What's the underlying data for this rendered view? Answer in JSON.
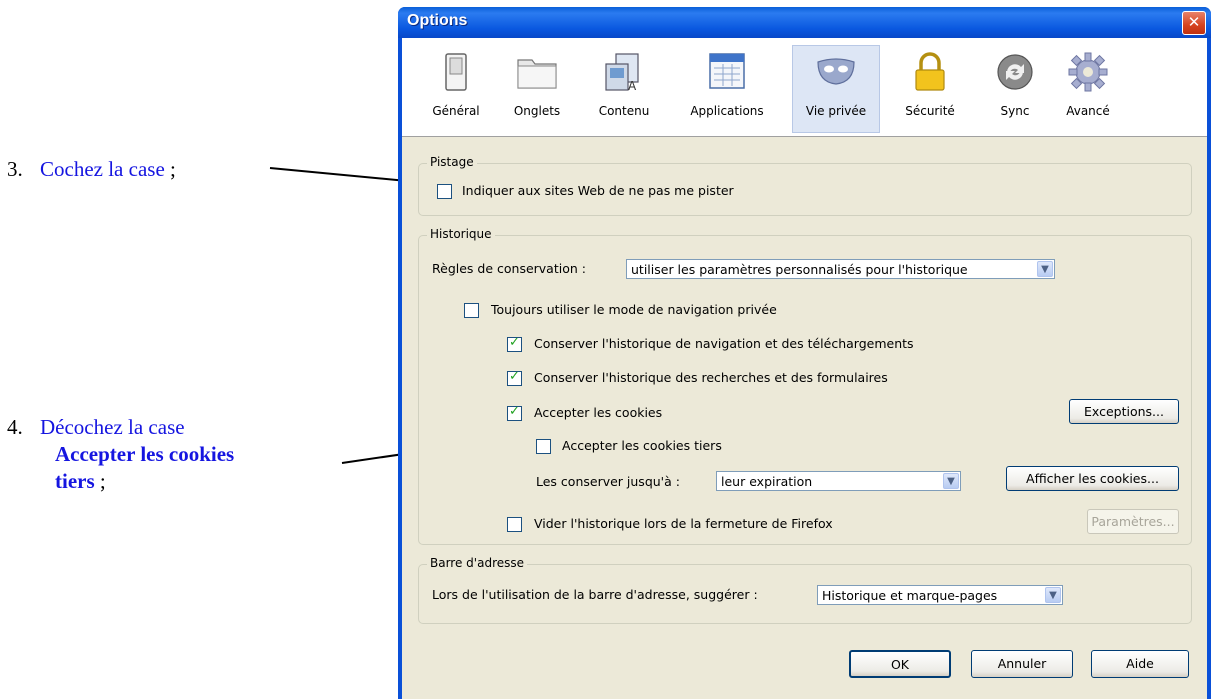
{
  "annotations": {
    "step3": {
      "number": "3.",
      "text": "Cochez la case",
      "suffix": " ;"
    },
    "step4": {
      "number": "4.",
      "text": "Décochez la case",
      "bold_line1": "Accepter les cookies",
      "bold_line2": "tiers",
      "suffix": " ;"
    }
  },
  "window": {
    "title": "Options",
    "close_glyph": "✕"
  },
  "toolbar": {
    "items": [
      {
        "label": "Général",
        "icon": "switch-icon"
      },
      {
        "label": "Onglets",
        "icon": "folder-tabs-icon"
      },
      {
        "label": "Contenu",
        "icon": "content-icon"
      },
      {
        "label": "Applications",
        "icon": "applications-icon"
      },
      {
        "label": "Vie privée",
        "icon": "mask-icon",
        "selected": true
      },
      {
        "label": "Sécurité",
        "icon": "padlock-icon"
      },
      {
        "label": "Sync",
        "icon": "sync-icon"
      },
      {
        "label": "Avancé",
        "icon": "gear-icon"
      }
    ]
  },
  "pistage": {
    "title": "Pistage",
    "do_not_track": {
      "label": "Indiquer aux sites Web de ne pas me pister",
      "checked": false
    }
  },
  "historique": {
    "title": "Historique",
    "retention_label": "Règles de conservation :",
    "retention_value": "utiliser les paramètres personnalisés pour l'historique",
    "always_private": {
      "label": "Toujours utiliser le mode de navigation privée",
      "checked": false
    },
    "keep_history": {
      "label": "Conserver l'historique de navigation et des téléchargements",
      "checked": true
    },
    "keep_search": {
      "label": "Conserver l'historique des recherches et des formulaires",
      "checked": true
    },
    "accept_cookies": {
      "label": "Accepter les cookies",
      "checked": true
    },
    "exceptions_button": "Exceptions...",
    "third_party": {
      "label": "Accepter les cookies tiers",
      "checked": false
    },
    "keep_until_label": "Les conserver jusqu'à :",
    "keep_until_value": "leur expiration",
    "show_cookies_button": "Afficher les cookies...",
    "clear_on_close": {
      "label": "Vider l'historique lors de la fermeture de Firefox",
      "checked": false
    },
    "settings_button": "Paramètres..."
  },
  "address_bar": {
    "title": "Barre d'adresse",
    "suggest_label": "Lors de l'utilisation de la barre d'adresse, suggérer :",
    "suggest_value": "Historique et marque-pages"
  },
  "footer": {
    "ok": "OK",
    "cancel": "Annuler",
    "help": "Aide"
  }
}
